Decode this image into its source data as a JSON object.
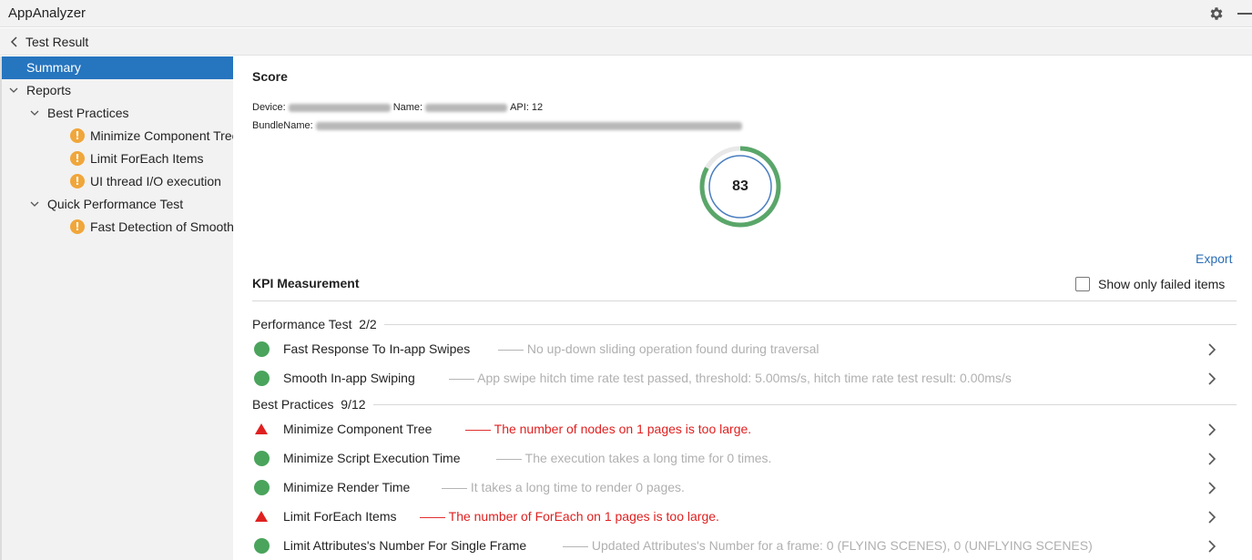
{
  "window": {
    "title": "AppAnalyzer"
  },
  "subbar": {
    "title": "Test Result"
  },
  "sidebar": {
    "items": [
      {
        "label": "Summary"
      },
      {
        "label": "Reports"
      },
      {
        "label": "Best Practices"
      },
      {
        "label": "Minimize Component Tree"
      },
      {
        "label": "Limit ForEach Items"
      },
      {
        "label": "UI thread I/O execution"
      },
      {
        "label": "Quick Performance Test"
      },
      {
        "label": "Fast Detection of Smooth"
      }
    ]
  },
  "score": {
    "heading": "Score",
    "device_label": "Device:",
    "name_label": "Name:",
    "api_text": "API: 12",
    "bundle_label": "BundleName:",
    "value": "83",
    "value_fraction": 0.83
  },
  "kpi": {
    "export_label": "Export",
    "heading": "KPI Measurement",
    "show_failed_label": "Show only failed items",
    "sections": [
      {
        "title": "Performance Test",
        "count": "2/2",
        "rows": [
          {
            "status": "pass",
            "name": "Fast Response To In-app Swipes",
            "desc": "—— No up-down sliding operation found during traversal"
          },
          {
            "status": "pass",
            "name": "Smooth In-app Swiping",
            "desc": "—— App swipe hitch time rate test passed, threshold: 5.00ms/s, hitch time rate test result: 0.00ms/s"
          }
        ]
      },
      {
        "title": "Best Practices",
        "count": "9/12",
        "rows": [
          {
            "status": "fail",
            "name": "Minimize Component Tree",
            "desc": "—— The number of nodes on 1 pages is too large."
          },
          {
            "status": "pass",
            "name": "Minimize Script Execution Time",
            "desc": "—— The execution takes a long time for 0 times."
          },
          {
            "status": "pass",
            "name": "Minimize Render Time",
            "desc": "—— It takes a long time to render 0 pages."
          },
          {
            "status": "fail",
            "name": "Limit ForEach Items",
            "desc": "—— The number of ForEach on 1 pages is too large."
          },
          {
            "status": "pass",
            "name": "Limit Attributes's Number For Single Frame",
            "desc": "—— Updated Attributes's Number for a frame: 0 (FLYING SCENES), 0 (UNFLYING SCENES)"
          }
        ]
      }
    ]
  },
  "icons": {
    "settings": "gear-icon",
    "back": "chevron-left-icon",
    "expand": "chevron-down-icon",
    "warning": "warning-icon",
    "pass": "green-circle-icon",
    "fail": "red-triangle-icon",
    "row_open": "chevron-right-icon"
  },
  "colors": {
    "selection": "#2675bf",
    "pass": "#4aa45c",
    "fail": "#e02020",
    "warning": "#f0a63a",
    "link": "#2b6fb6",
    "score_ring": "#5aa66a",
    "score_inner_ring": "#4a7ec0"
  }
}
